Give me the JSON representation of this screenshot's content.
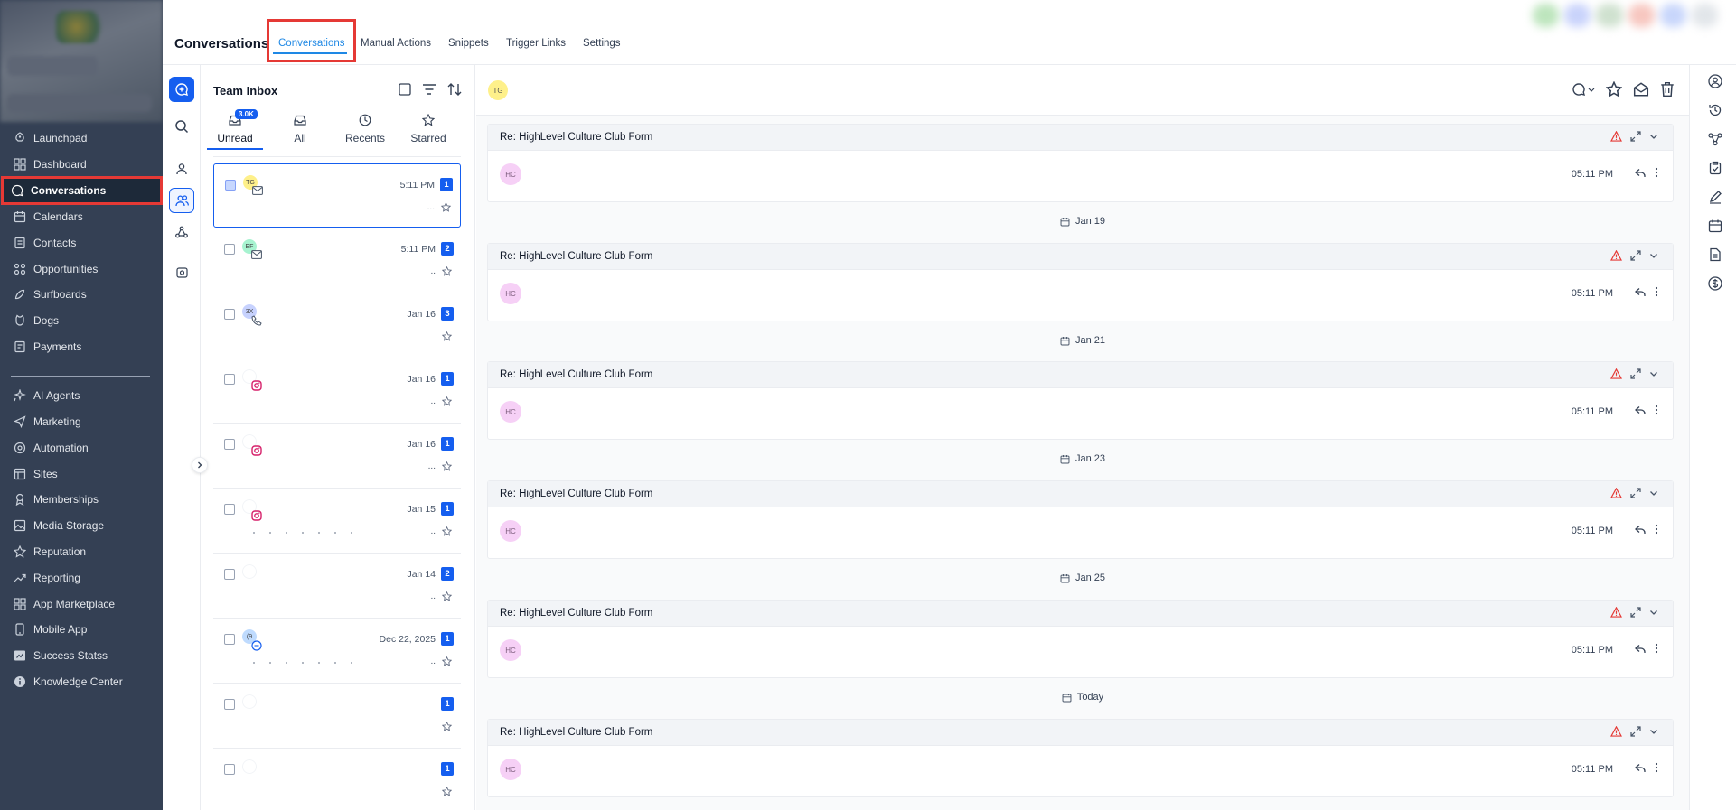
{
  "sidebar": {
    "items": [
      {
        "label": "Launchpad",
        "icon": "rocket-icon"
      },
      {
        "label": "Dashboard",
        "icon": "dashboard-icon"
      },
      {
        "label": "Conversations",
        "icon": "chat-bubble-icon"
      },
      {
        "label": "Calendars",
        "icon": "calendar-icon"
      },
      {
        "label": "Contacts",
        "icon": "contacts-icon"
      },
      {
        "label": "Opportunities",
        "icon": "opportunities-icon"
      },
      {
        "label": "Surfboards",
        "icon": "surfboard-icon"
      },
      {
        "label": "Dogs",
        "icon": "dog-icon"
      },
      {
        "label": "Payments",
        "icon": "payments-icon"
      },
      {
        "label": "AI Agents",
        "icon": "ai-sparkle-icon"
      },
      {
        "label": "Marketing",
        "icon": "send-icon"
      },
      {
        "label": "Automation",
        "icon": "automation-icon"
      },
      {
        "label": "Sites",
        "icon": "sites-icon"
      },
      {
        "label": "Memberships",
        "icon": "memberships-icon"
      },
      {
        "label": "Media Storage",
        "icon": "image-icon"
      },
      {
        "label": "Reputation",
        "icon": "star-icon"
      },
      {
        "label": "Reporting",
        "icon": "trend-icon"
      },
      {
        "label": "App Marketplace",
        "icon": "grid-icon"
      },
      {
        "label": "Mobile App",
        "icon": "phone-icon"
      },
      {
        "label": "Success Statss",
        "icon": "stats-icon"
      },
      {
        "label": "Knowledge Center",
        "icon": "info-icon"
      }
    ],
    "active": "Conversations"
  },
  "header": {
    "title": "Conversations",
    "tabs": [
      {
        "label": "Conversations",
        "active": true
      },
      {
        "label": "Manual Actions"
      },
      {
        "label": "Snippets"
      },
      {
        "label": "Trigger Links"
      },
      {
        "label": "Settings"
      }
    ]
  },
  "inbox": {
    "title": "Team Inbox",
    "unread_badge": "3.0K",
    "tabs": [
      {
        "label": "Unread",
        "icon": "inbox-tray-icon"
      },
      {
        "label": "All",
        "icon": "inbox-tray-icon"
      },
      {
        "label": "Recents",
        "icon": "clock-icon"
      },
      {
        "label": "Starred",
        "icon": "star-outline-icon"
      }
    ],
    "rows": [
      {
        "avatar": "TG",
        "avatar_color": "#fef08a",
        "channel": "email",
        "time": "5:11 PM",
        "count": "1",
        "dots": "...",
        "selected": true
      },
      {
        "avatar": "EF",
        "avatar_color": "#a7f3d0",
        "channel": "email",
        "time": "5:11 PM",
        "count": "2",
        "dots": ".."
      },
      {
        "avatar": "3X",
        "avatar_color": "#c7d2fe",
        "channel": "phone",
        "time": "Jan 16",
        "count": "3",
        "dots": ""
      },
      {
        "avatar": "",
        "avatar_color": "#ffffff",
        "channel": "instagram",
        "time": "Jan 16",
        "count": "1",
        "dots": ".."
      },
      {
        "avatar": "",
        "avatar_color": "#ffffff",
        "channel": "instagram",
        "time": "Jan 16",
        "count": "1",
        "dots": "..."
      },
      {
        "avatar": "",
        "avatar_color": "#ffffff",
        "channel": "instagram",
        "time": "Jan 15",
        "count": "1",
        "dots": ".."
      },
      {
        "avatar": "",
        "avatar_color": "#ffffff",
        "channel": "",
        "time": "Jan 14",
        "count": "2",
        "dots": ".."
      },
      {
        "avatar": "(9",
        "avatar_color": "#bfdbfe",
        "channel": "chat",
        "time": "Dec 22, 2025",
        "count": "1",
        "dots": ".."
      },
      {
        "avatar": "",
        "avatar_color": "#ffffff",
        "channel": "",
        "time": "",
        "count": "1",
        "dots": ""
      },
      {
        "avatar": "",
        "avatar_color": "#ffffff",
        "channel": "",
        "time": "",
        "count": "1",
        "dots": ""
      }
    ]
  },
  "chat": {
    "contact_initials": "TG",
    "messages": [
      {
        "subject": "Re: HighLevel Culture Club Form",
        "sender": "HC",
        "time": "05:11 PM"
      },
      {
        "date": "Jan 19"
      },
      {
        "subject": "Re: HighLevel Culture Club Form",
        "sender": "HC",
        "time": "05:11 PM"
      },
      {
        "date": "Jan 21"
      },
      {
        "subject": "Re: HighLevel Culture Club Form",
        "sender": "HC",
        "time": "05:11 PM"
      },
      {
        "date": "Jan 23"
      },
      {
        "subject": "Re: HighLevel Culture Club Form",
        "sender": "HC",
        "time": "05:11 PM"
      },
      {
        "date": "Jan 25"
      },
      {
        "subject": "Re: HighLevel Culture Club Form",
        "sender": "HC",
        "time": "05:11 PM"
      },
      {
        "date": "Today"
      },
      {
        "subject": "Re: HighLevel Culture Club Form",
        "sender": "HC",
        "time": "05:11 PM"
      }
    ]
  },
  "colors": {
    "sidebar_bg": "#344054",
    "accent": "#155eef",
    "highlight": "#e53935",
    "error": "#e53935"
  }
}
